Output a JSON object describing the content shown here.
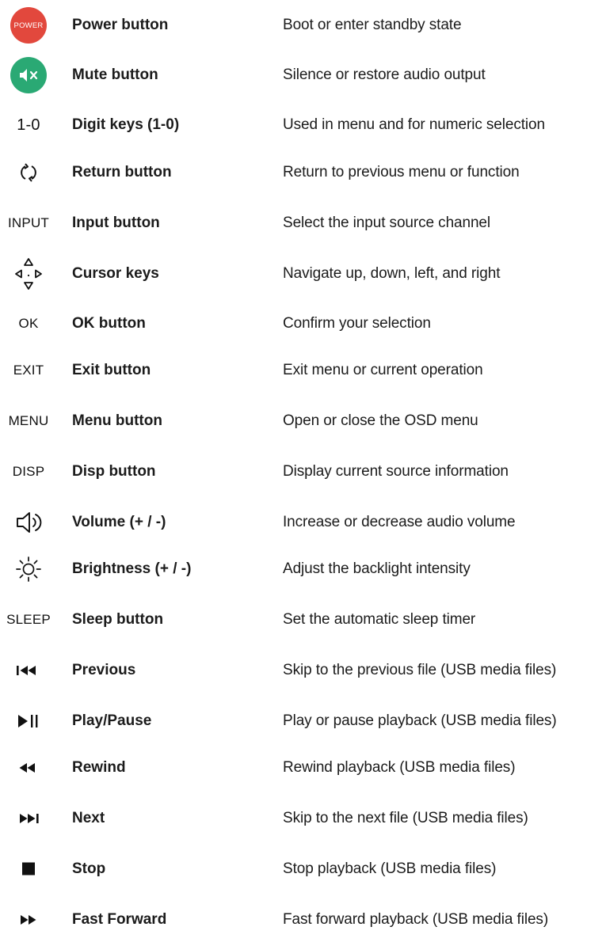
{
  "colors": {
    "power": "#e2483d",
    "mute": "#2aa974",
    "text": "#1b1b1b"
  },
  "rows": [
    {
      "icon": "power-badge-icon",
      "icon_text": "POWER",
      "name": "Power button",
      "desc": "Boot or enter standby state"
    },
    {
      "icon": "mute-icon",
      "name": "Mute button",
      "desc": "Silence or restore audio output"
    },
    {
      "icon": "digits-icon",
      "icon_text": "1-0",
      "name": "Digit keys (1-0)",
      "desc": "Used in menu and for numeric selection"
    },
    {
      "icon": "return-icon",
      "name": "Return button",
      "desc": "Return to previous menu or function"
    },
    {
      "icon": "input-icon",
      "icon_text": "INPUT",
      "name": "Input button",
      "desc": "Select the input source channel"
    },
    {
      "icon": "cursor-keys-icon",
      "name": "Cursor keys",
      "desc": "Navigate up, down, left, and right"
    },
    {
      "icon": "ok-icon",
      "icon_text": "OK",
      "name": "OK button",
      "desc": "Confirm your selection"
    },
    {
      "icon": "exit-icon",
      "icon_text": "EXIT",
      "name": "Exit button",
      "desc": "Exit menu or current operation"
    },
    {
      "icon": "menu-icon",
      "icon_text": "MENU",
      "name": "Menu button",
      "desc": "Open or close the OSD menu"
    },
    {
      "icon": "disp-icon",
      "icon_text": "DISP",
      "name": "Disp button",
      "desc": "Display current source information"
    },
    {
      "icon": "volume-icon",
      "name": "Volume (+ / -)",
      "desc": "Increase or decrease audio volume"
    },
    {
      "icon": "brightness-icon",
      "name": "Brightness (+ / -)",
      "desc": "Adjust the backlight intensity"
    },
    {
      "icon": "sleep-icon",
      "icon_text": "SLEEP",
      "name": "Sleep button",
      "desc": "Set the automatic sleep timer"
    },
    {
      "icon": "previous-icon",
      "name": "Previous",
      "desc": "Skip to the previous file (USB media files)"
    },
    {
      "icon": "play-pause-icon",
      "name": "Play/Pause",
      "desc": "Play or pause playback (USB media files)"
    },
    {
      "icon": "rewind-icon",
      "name": "Rewind",
      "desc": "Rewind playback (USB media files)"
    },
    {
      "icon": "next-icon",
      "name": "Next",
      "desc": "Skip to the next file (USB media files)"
    },
    {
      "icon": "stop-icon",
      "name": "Stop",
      "desc": "Stop playback (USB media files)"
    },
    {
      "icon": "fast-forward-icon",
      "name": "Fast Forward",
      "desc": "Fast forward playback (USB media files)"
    }
  ]
}
